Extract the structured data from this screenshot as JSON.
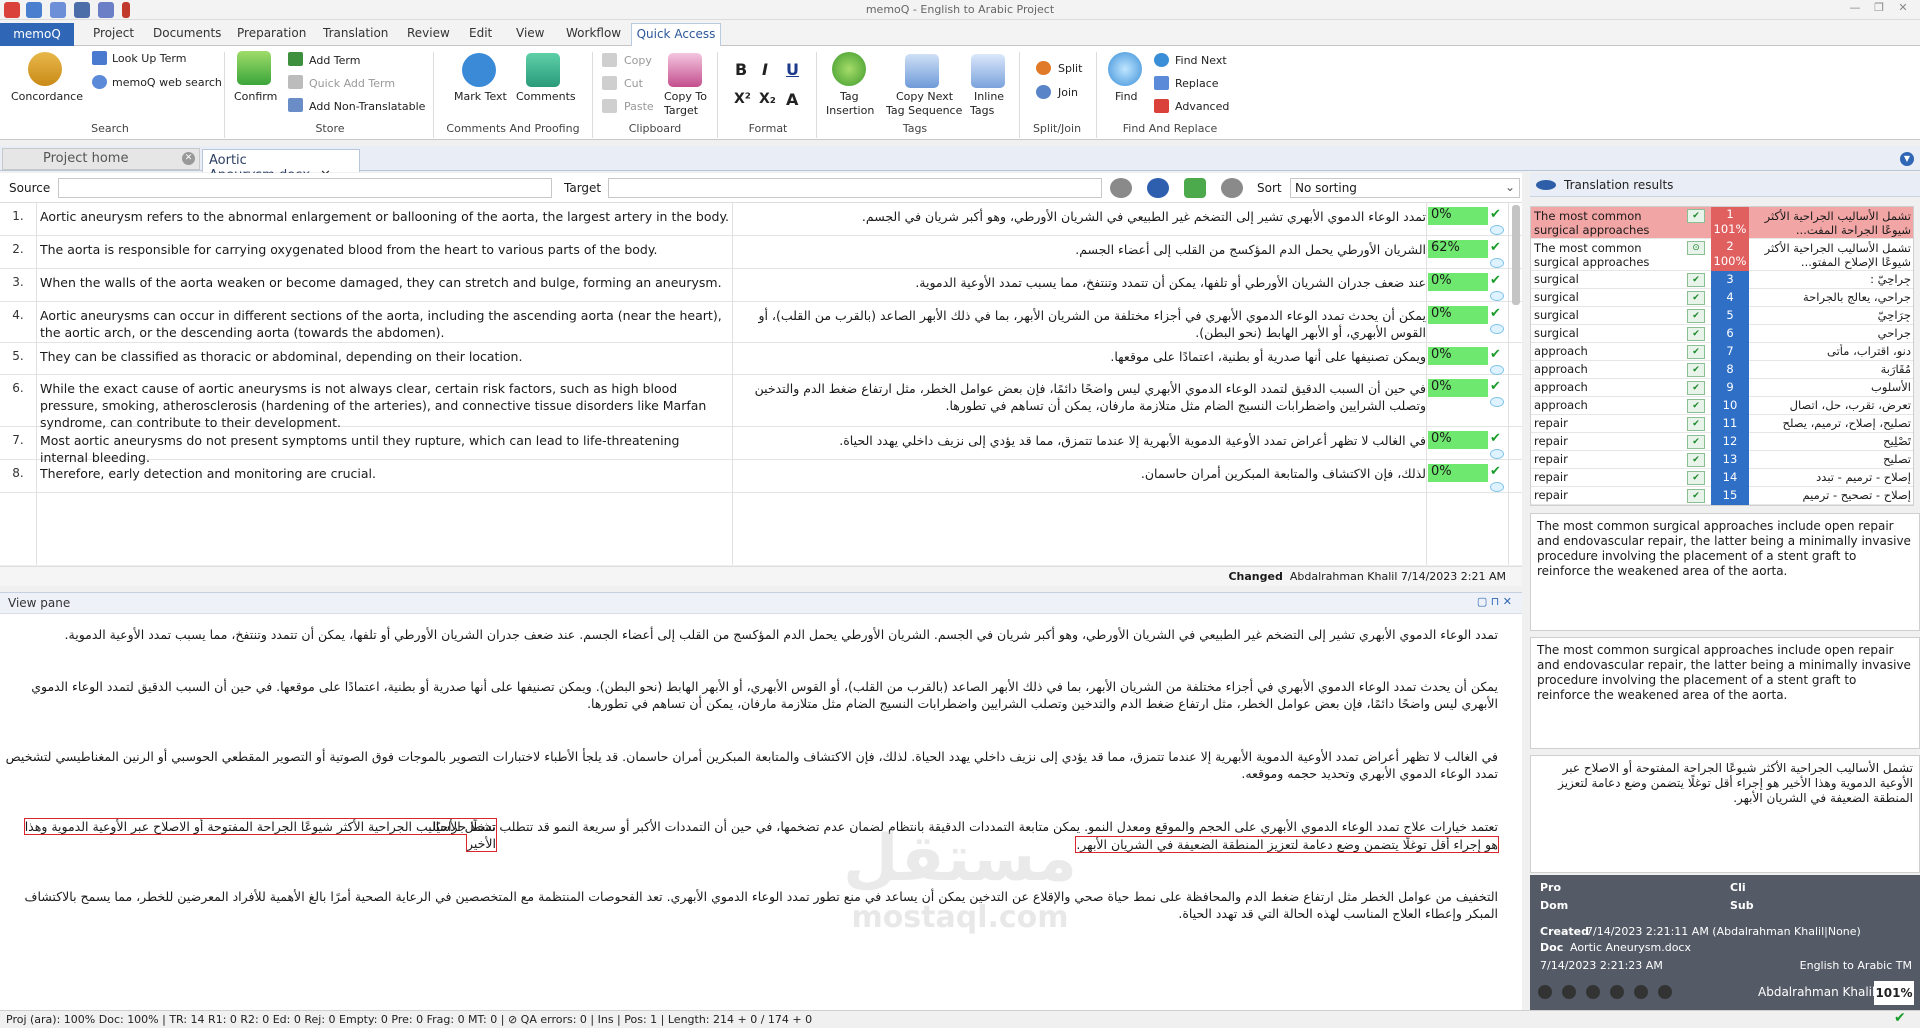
{
  "window": {
    "title": "memoQ - English to Arabic Project"
  },
  "menu_tabs": [
    "memoQ",
    "Project",
    "Documents",
    "Preparation",
    "Translation",
    "Review",
    "Edit",
    "View",
    "Workflow",
    "Quick Access"
  ],
  "ribbon": {
    "concordance": "Concordance",
    "lookup_term": "Look Up Term",
    "memoq_web_search": "memoQ web search",
    "group_search": "Search",
    "confirm": "Confirm",
    "add_term": "Add Term",
    "quick_add_term": "Quick Add Term",
    "add_non_translatable": "Add Non-Translatable",
    "group_store": "Store",
    "mark_text": "Mark Text",
    "comments": "Comments",
    "group_comments": "Comments And Proofing",
    "copy": "Copy",
    "cut": "Cut",
    "paste": "Paste",
    "copy_to_target": "Copy To",
    "copy_to_target2": "Target",
    "group_clipboard": "Clipboard",
    "group_format": "Format",
    "bold": "B",
    "italic": "I",
    "underline": "U",
    "superscript": "X²",
    "subscript": "X₂",
    "case": "A",
    "tag_insertion": "Tag",
    "tag_insertion2": "Insertion",
    "copy_next_tag": "Copy Next",
    "copy_next_tag2": "Tag Sequence",
    "inline_tags": "Inline",
    "inline_tags2": "Tags",
    "group_tags": "Tags",
    "split": "Split",
    "join": "Join",
    "group_splitjoin": "Split/Join",
    "find": "Find",
    "find_next": "Find Next",
    "replace": "Replace",
    "advanced": "Advanced",
    "group_find": "Find And Replace"
  },
  "doc_tabs": {
    "project_home": "Project home",
    "document": "Aortic Aneurysm.docx"
  },
  "filter": {
    "source_label": "Source",
    "target_label": "Target",
    "sort_label": "Sort",
    "sort_value": "No sorting"
  },
  "segments": [
    {
      "n": "1.",
      "src": "Aortic aneurysm refers to the abnormal enlargement or ballooning of the aorta, the largest artery in the body.",
      "tgt": "تمدد الوعاء الدموي الأبهري تشير إلى التضخم غير الطبيعي في الشريان الأورطي، وهو أكبر شريان في الجسم.",
      "pct": "0%"
    },
    {
      "n": "2.",
      "src": "The aorta is responsible for carrying oxygenated blood from the heart to various parts of the body.",
      "tgt": "الشريان الأورطي يحمل الدم المؤكسج من القلب إلى أعضاء الجسم.",
      "pct": "62%"
    },
    {
      "n": "3.",
      "src": "When the walls of the aorta weaken or become damaged, they can stretch and bulge, forming an aneurysm.",
      "tgt": "عند ضعف جدران الشريان الأورطي أو تلفها، يمكن أن تتمدد وتنتفخ، مما يسبب تمدد الأوعية الدموية.",
      "pct": "0%"
    },
    {
      "n": "4.",
      "src": "Aortic aneurysms can occur in different sections of the aorta, including the ascending aorta (near the heart), the aortic arch, or the descending aorta (towards the abdomen).",
      "tgt": "يمكن أن يحدث تمدد الوعاء الدموي الأبهري في أجزاء مختلفة من الشريان الأبهر، بما في ذلك الأبهر الصاعد (بالقرب من القلب)، أو القوس الأبهري، أو الأبهر الهابط (نحو البطن).",
      "pct": "0%"
    },
    {
      "n": "5.",
      "src": "They can be classified as thoracic or abdominal, depending on their location.",
      "tgt": "ويمكن تصنيفها على أنها صدرية أو بطنية، اعتمادًا على موقعها.",
      "pct": "0%"
    },
    {
      "n": "6.",
      "src": "While the exact cause of aortic aneurysms is not always clear, certain risk factors, such as high blood pressure, smoking, atherosclerosis (hardening of the arteries), and connective tissue disorders like Marfan syndrome, can contribute to their development.",
      "tgt": "في حين أن السبب الدقيق لتمدد الوعاء الدموي الأبهري ليس واضحًا دائمًا، فإن بعض عوامل الخطر، مثل ارتفاع ضغط الدم والتدخين وتصلب الشرايين واضطرابات النسيج الضام مثل متلازمة مارفان، يمكن أن تساهم في تطورها.",
      "pct": "0%"
    },
    {
      "n": "7.",
      "src": "Most aortic aneurysms do not present symptoms until they rupture, which can lead to life-threatening internal bleeding.",
      "tgt": "في الغالب  لا تظهر أعراض تمدد الأوعية الدموية الأبهرية إلا عندما تتمزق، مما قد يؤدي إلى نزيف داخلي يهدد الحياة.",
      "pct": "0%"
    },
    {
      "n": "8.",
      "src": "Therefore, early detection and monitoring are crucial.",
      "tgt": "لذلك، فإن الاكتشاف والمتابعة المبكرين أمران حاسمان.",
      "pct": "0%"
    }
  ],
  "changed": {
    "label": "Changed",
    "value": "Abdalrahman Khalil 7/14/2023 2:21 AM"
  },
  "view_pane": {
    "title": "View pane",
    "paragraphs": [
      "تمدد الوعاء الدموي الأبهري تشير إلى التضخم غير الطبيعي في الشريان الأورطي، وهو أكبر شريان في الجسم. الشريان الأورطي يحمل الدم المؤكسج من القلب إلى أعضاء الجسم. عند ضعف جدران الشريان الأورطي أو تلفها، يمكن أن تتمدد وتنتفخ، مما يسبب تمدد الأوعية الدموية.",
      "يمكن أن يحدث تمدد الوعاء الدموي الأبهري في أجزاء مختلفة من الشريان الأبهر، بما في ذلك الأبهر الصاعد (بالقرب من القلب)، أو القوس الأبهري، أو الأبهر الهابط (نحو البطن).  ويمكن تصنيفها على أنها صدرية أو بطنية، اعتمادًا على موقعها. في حين أن السبب الدقيق لتمدد الوعاء الدموي الأبهري ليس واضحًا دائمًا، فإن بعض عوامل الخطر، مثل ارتفاع ضغط الدم والتدخين وتصلب الشرايين واضطرابات النسيج الضام مثل متلازمة مارفان، يمكن أن تساهم في تطورها.",
      "في الغالب  لا تظهر أعراض تمدد الأوعية الدموية الأبهرية إلا عندما تتمزق، مما قد يؤدي إلى نزيف داخلي يهدد الحياة. لذلك، فإن الاكتشاف والمتابعة المبكرين أمران حاسمان.  قد يلجأ الأطباء لاختبارات التصوير بالموجات فوق الصوتية أو التصوير المقطعي الحوسبي أو الرنين المغناطيسي لتشخيص تمدد الوعاء الدموي الأبهري وتحديد حجمه وموقعه.",
      "تعتمد خيارات علاج تمدد الوعاء الدموي الأبهري على الحجم والموقع ومعدل النمو.  يمكن متابعة التمددات الدقيقة بانتظام لضمان عدم تضخمها، في حين أن التمددات الأكبر أو سريعة النمو قد تتطلب تدخلًا جراحيًا.",
      "تشمل الأساليب الجراحية الأكثر شيوعًا الجراحة المفتوحة أو الاصلاح عبر الأوعية الدموية وهذا الأخير",
      "هو إجراء أقل توغلًا يتضمن وضع دعامة لتعزيز المنطقة الضعيفة في الشريان الأبهر.",
      "التخفيف من عوامل الخطر مثل ارتفاع ضغط الدم والمحافظة على نمط حياة صحي والإقلاع عن التدخين يمكن أن يساعد في منع تطور تمدد الوعاء الدموي الأبهري. تعد الفحوصات المنتظمة مع المتخصصين في الرعاية الصحية أمرًا بالغ الأهمية للأفراد المعرضين للخطر، مما يسمح بالاكتشاف المبكر وإعطاء العلاج المناسب لهذه الحالة التي قد تهدد الحياة."
    ]
  },
  "translation_results": {
    "title": "Translation results",
    "rows": [
      {
        "src": "The most common surgical approaches include ope...",
        "num": "1",
        "num2": "101%",
        "tgt": "تشمل الأساليب الجراحية الأكثر شيوعًا الجراحة المفت..."
      },
      {
        "src": "The most common surgical approaches include ope...",
        "num": "2",
        "num2": "100%",
        "tgt": "تشمل الأساليب الجراحية الأكثر شيوعًا الإصلاح المفتو..."
      },
      {
        "src": "surgical",
        "num": "3",
        "tgt": "جِراحِيّ :"
      },
      {
        "src": "surgical",
        "num": "4",
        "tgt": "جراحي، يعالج بالجراحة"
      },
      {
        "src": "surgical",
        "num": "5",
        "tgt": "جِرَاحِيّ"
      },
      {
        "src": "surgical",
        "num": "6",
        "tgt": "جراحي"
      },
      {
        "src": "approach",
        "num": "7",
        "tgt": "دنو، اقتراب، مأتى"
      },
      {
        "src": "approach",
        "num": "8",
        "tgt": "مُقَارَبة"
      },
      {
        "src": "approach",
        "num": "9",
        "tgt": "الأسلوب"
      },
      {
        "src": "approach",
        "num": "10",
        "tgt": "تعرض، تقرب، حل، اتصال"
      },
      {
        "src": "repair",
        "num": "11",
        "tgt": "تصليح، إصلاح، ترميم، يصلح"
      },
      {
        "src": "repair",
        "num": "12",
        "tgt": "تَصْلِيح"
      },
      {
        "src": "repair",
        "num": "13",
        "tgt": "تصليح"
      },
      {
        "src": "repair",
        "num": "14",
        "tgt": "إصلاح - ترميم - تبدد"
      },
      {
        "src": "repair",
        "num": "15",
        "tgt": "إصلاح - تصحيح - ترميم"
      }
    ],
    "source_preview": "The most common surgical approaches include open repair and endovascular repair, the latter being a minimally invasive procedure involving the placement of a stent graft to reinforce the weakened area of the aorta.",
    "match_preview": "The most common surgical approaches include open repair and endovascular repair, the latter being a minimally invasive procedure involving the placement of a stent graft to reinforce the weakened area of the aorta.",
    "target_preview": "تشمل الأساليب الجراحية الأكثر شيوعًا الجراحة المفتوحة أو الاصلاح عبر الأوعية الدموية وهذا الأخير هو إجراء أقل توغلًا يتضمن وضع دعامة لتعزيز المنطقة الضعيفة في الشريان الأبهر."
  },
  "meta": {
    "pro": "Pro",
    "cli": "Cli",
    "dom": "Dom",
    "sub": "Sub",
    "created_label": "Created",
    "created": "7/14/2023 2:21:11 AM (Abdalrahman Khalil|None)",
    "doc_label": "Doc",
    "doc": "Aortic Aneurysm.docx",
    "date": "7/14/2023 2:21:23 AM",
    "tm": "English to Arabic TM",
    "user": "Abdalrahman Khalil",
    "pct": "101%"
  },
  "status": "Proj (ara): 100%  Doc: 100%  |  TR: 14   R1: 0   R2: 0   Ed: 0   Rej: 0   Empty: 0   Pre: 0   Frag: 0   MT: 0  |  ⊘ QA errors: 0  |  Ins  |  Pos: 1  |  Length: 214 + 0 / 174 + 0",
  "watermark": {
    "ar": "مستقل",
    "en": "mostaql.com"
  },
  "colors": {
    "accent": "#2f66b5",
    "match_green": "#6ee86e",
    "highlight_red": "#d9262c",
    "hit_red": "#e06060"
  }
}
